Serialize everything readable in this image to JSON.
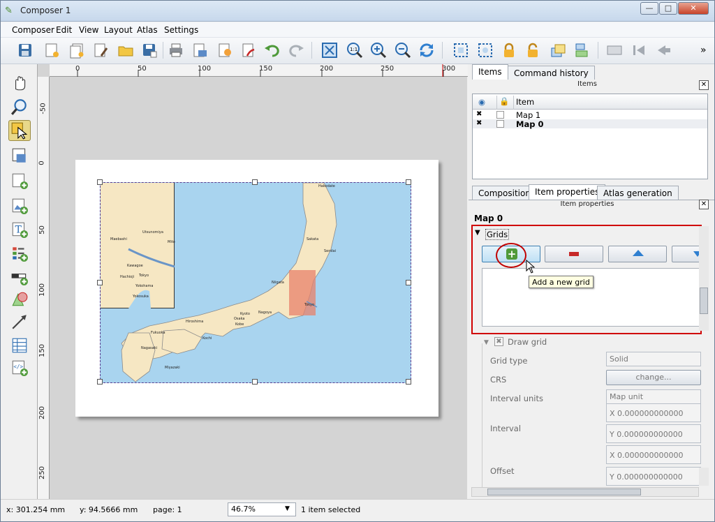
{
  "window": {
    "title": "Composer 1",
    "buttons": {
      "minimize": "—",
      "maximize": "□",
      "close": "✕"
    }
  },
  "menu": [
    "Composer",
    "Edit",
    "View",
    "Layout",
    "Atlas",
    "Settings"
  ],
  "toolbar": {
    "more": "»"
  },
  "ruler": {
    "h_ticks": [
      "0",
      "50",
      "100",
      "150",
      "200",
      "250",
      "300"
    ],
    "v_ticks": [
      "-50",
      "0",
      "50",
      "100",
      "150",
      "200",
      "250"
    ]
  },
  "map": {
    "city_labels": [
      "Hakodate",
      "Sakata",
      "Sendai",
      "Niigata",
      "Tokyo",
      "Nagoya",
      "Kyoto",
      "Osaka",
      "Kobe",
      "Hiroshima",
      "Kochi",
      "Fukuoka",
      "Nagasaki",
      "Miyazaki"
    ],
    "inset_labels": [
      "Utsunomiya",
      "Maebashi",
      "Tokyo",
      "Kawagoe",
      "Hachioji",
      "Yokohama",
      "Yokosuka",
      "Mito"
    ]
  },
  "right_panel": {
    "top_tabs": [
      "Items",
      "Command history"
    ],
    "items_dock_title": "Items",
    "items_columns": [
      "Item"
    ],
    "items": [
      {
        "name": "Map 1",
        "visible": "✖",
        "bold": false
      },
      {
        "name": "Map 0",
        "visible": "✖",
        "bold": true
      }
    ],
    "bottom_tabs": [
      "Composition",
      "Item properties",
      "Atlas generation"
    ],
    "props_dock_title": "Item properties",
    "map_name": "Map 0",
    "grids_label": "Grids",
    "tooltip": "Add a new grid",
    "draw_grid_label": "Draw grid",
    "props": {
      "grid_type_label": "Grid type",
      "grid_type_value": "Solid",
      "crs_label": "CRS",
      "crs_button": "change...",
      "interval_units_label": "Interval units",
      "interval_units_value": "Map unit",
      "interval_label": "Interval",
      "interval_x": "X 0.000000000000",
      "interval_y": "Y 0.000000000000",
      "offset_label": "Offset",
      "offset_x": "X 0.000000000000",
      "offset_y": "Y 0.000000000000"
    },
    "highlight_color": "#d00000"
  },
  "status": {
    "x": "x: 301.254 mm",
    "y": "y: 94.5666 mm",
    "page": "page: 1",
    "zoom": "46.7%",
    "selected": "1 item selected"
  }
}
